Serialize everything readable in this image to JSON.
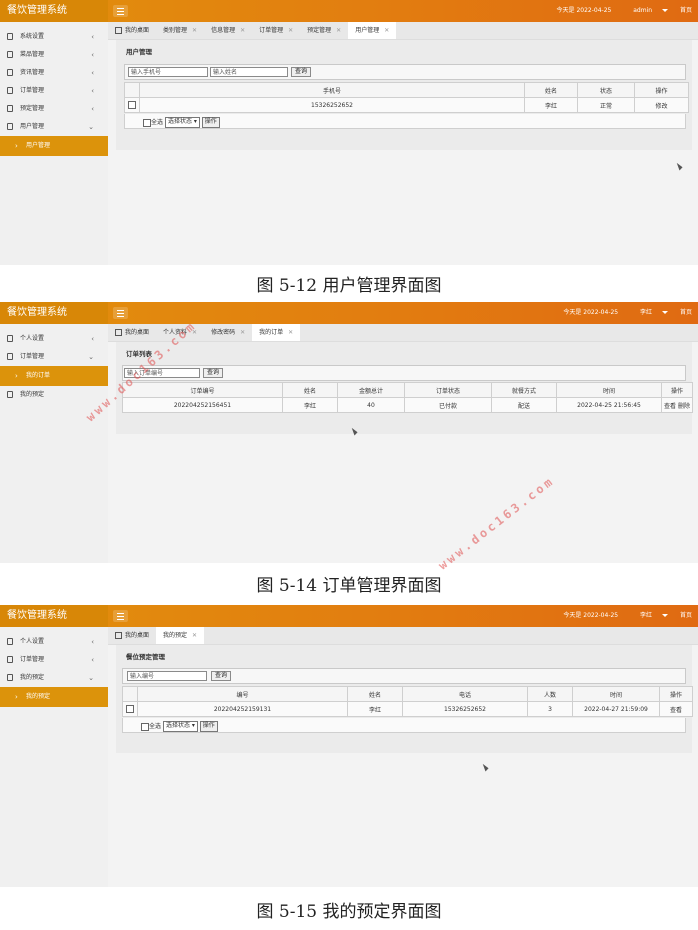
{
  "app": {
    "title": "餐饮管理系统",
    "today_text": "今天是 2022-04-25",
    "home_link": "首页"
  },
  "shots": [
    {
      "user": "admin",
      "sidebar": [
        {
          "label": "系统设置",
          "chevron": "‹"
        },
        {
          "label": "菜品管理",
          "chevron": "‹"
        },
        {
          "label": "资讯管理",
          "chevron": "‹"
        },
        {
          "label": "订单管理",
          "chevron": "‹"
        },
        {
          "label": "预定管理",
          "chevron": "‹"
        },
        {
          "label": "用户管理",
          "chevron": "⌄"
        }
      ],
      "sidebar_active": "用户管理",
      "tabs": [
        "我的桌面",
        "类别管理",
        "信息管理",
        "订单管理",
        "预定管理",
        "用户管理"
      ],
      "page_title": "用户管理",
      "search_placeholders": [
        "输入手机号",
        "输入姓名"
      ],
      "search_button": "查询",
      "headers": [
        "手机号",
        "姓名",
        "状态",
        "操作"
      ],
      "row": [
        "15326252652",
        "李红",
        "正常",
        "修改"
      ],
      "select_all": "全选",
      "select_status": "选择状态",
      "operate": "操作",
      "caption": "图 5-12 用户管理界面图"
    },
    {
      "user": "李红",
      "sidebar": [
        {
          "label": "个人设置",
          "chevron": "‹"
        },
        {
          "label": "订单管理",
          "chevron": "⌄"
        }
      ],
      "sidebar_active": "我的订单",
      "sidebar_after": "我的预定",
      "tabs": [
        "我的桌面",
        "个人资料",
        "修改密码",
        "我的订单"
      ],
      "page_title": "订单列表",
      "search_placeholder": "输入订单编号",
      "search_button": "查询",
      "headers": [
        "订单编号",
        "姓名",
        "金额总计",
        "订单状态",
        "就餐方式",
        "时间",
        "操作"
      ],
      "row": [
        "202204252156451",
        "李红",
        "40",
        "已付款",
        "配送",
        "2022-04-25 21:56:45",
        "查看 删除"
      ],
      "caption": "图 5-14 订单管理界面图"
    },
    {
      "user": "李红",
      "sidebar": [
        {
          "label": "个人设置",
          "chevron": "‹"
        },
        {
          "label": "订单管理",
          "chevron": "‹"
        },
        {
          "label": "我的预定",
          "chevron": "⌄"
        }
      ],
      "sidebar_active": "我的预定",
      "tabs": [
        "我的桌面",
        "我的预定"
      ],
      "page_title": "餐位预定管理",
      "search_placeholder": "输入编号",
      "search_button": "查询",
      "headers": [
        "编号",
        "姓名",
        "电话",
        "人数",
        "时间",
        "操作"
      ],
      "row": [
        "202204252159131",
        "李红",
        "15326252652",
        "3",
        "2022-04-27 21:59:09",
        "查看"
      ],
      "select_all": "全选",
      "select_status": "选择状态",
      "operate": "操作",
      "caption": "图 5-15 我的预定界面图"
    }
  ],
  "watermark": "www.doc163.com",
  "colors": {
    "topbar": "#e2800f",
    "active_side": "#dc930b",
    "content_bg": "#ebebeb"
  }
}
